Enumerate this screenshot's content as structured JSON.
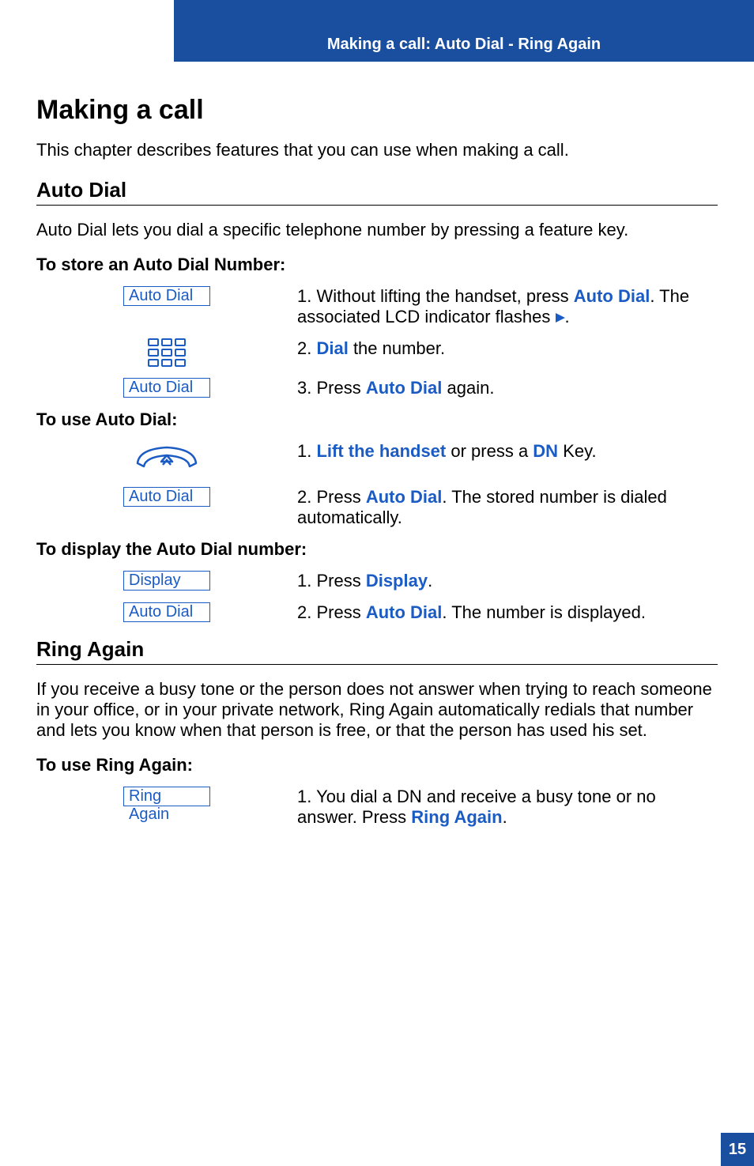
{
  "header": {
    "title": "Making a call: Auto Dial - Ring Again"
  },
  "h1": "Making a call",
  "intro": "This chapter describes features that you can use when making a call.",
  "autoDial": {
    "heading": "Auto Dial",
    "lead": "Auto Dial lets you dial a specific telephone number by pressing a feature key.",
    "storeHeading": "To store an Auto Dial Number:",
    "key1": "Auto Dial",
    "step1a": "1. Without lifting the handset, press ",
    "step1b": "Auto Dial",
    "step1c": ". The associated LCD indicator flashes ",
    "step1d": ".",
    "step2a": "2. ",
    "step2b": "Dial",
    "step2c": " the number.",
    "key3": "Auto Dial",
    "step3a": "3. Press ",
    "step3b": "Auto Dial",
    "step3c": " again.",
    "useHeading": "To use Auto Dial:",
    "ustep1a": "1. ",
    "ustep1b": "Lift the handset",
    "ustep1c": " or press a ",
    "ustep1d": "DN",
    "ustep1e": " Key.",
    "keyU2": "Auto Dial",
    "ustep2a": "2. Press ",
    "ustep2b": "Auto Dial",
    "ustep2c": ". The stored number is dialed automatically.",
    "displayHeading": "To display the Auto Dial number:",
    "keyD1": "Display",
    "dstep1a": "1. Press ",
    "dstep1b": "Display",
    "dstep1c": ".",
    "keyD2": "Auto Dial",
    "dstep2a": "2. Press ",
    "dstep2b": "Auto Dial",
    "dstep2c": ". The number is dis­played."
  },
  "ringAgain": {
    "heading": "Ring Again",
    "lead": "If you receive a busy tone or the person does not answer when trying to reach someone in your office, or in your private network, Ring Again automatically redials that number and lets you know when that person is free, or that the person has used his set.",
    "useHeading": "To use Ring Again:",
    "key1": "Ring Again",
    "step1a": "1. You dial a DN and receive a busy tone or no answer. Press ",
    "step1b": "Ring Again",
    "step1c": "."
  },
  "pageNumber": "15"
}
